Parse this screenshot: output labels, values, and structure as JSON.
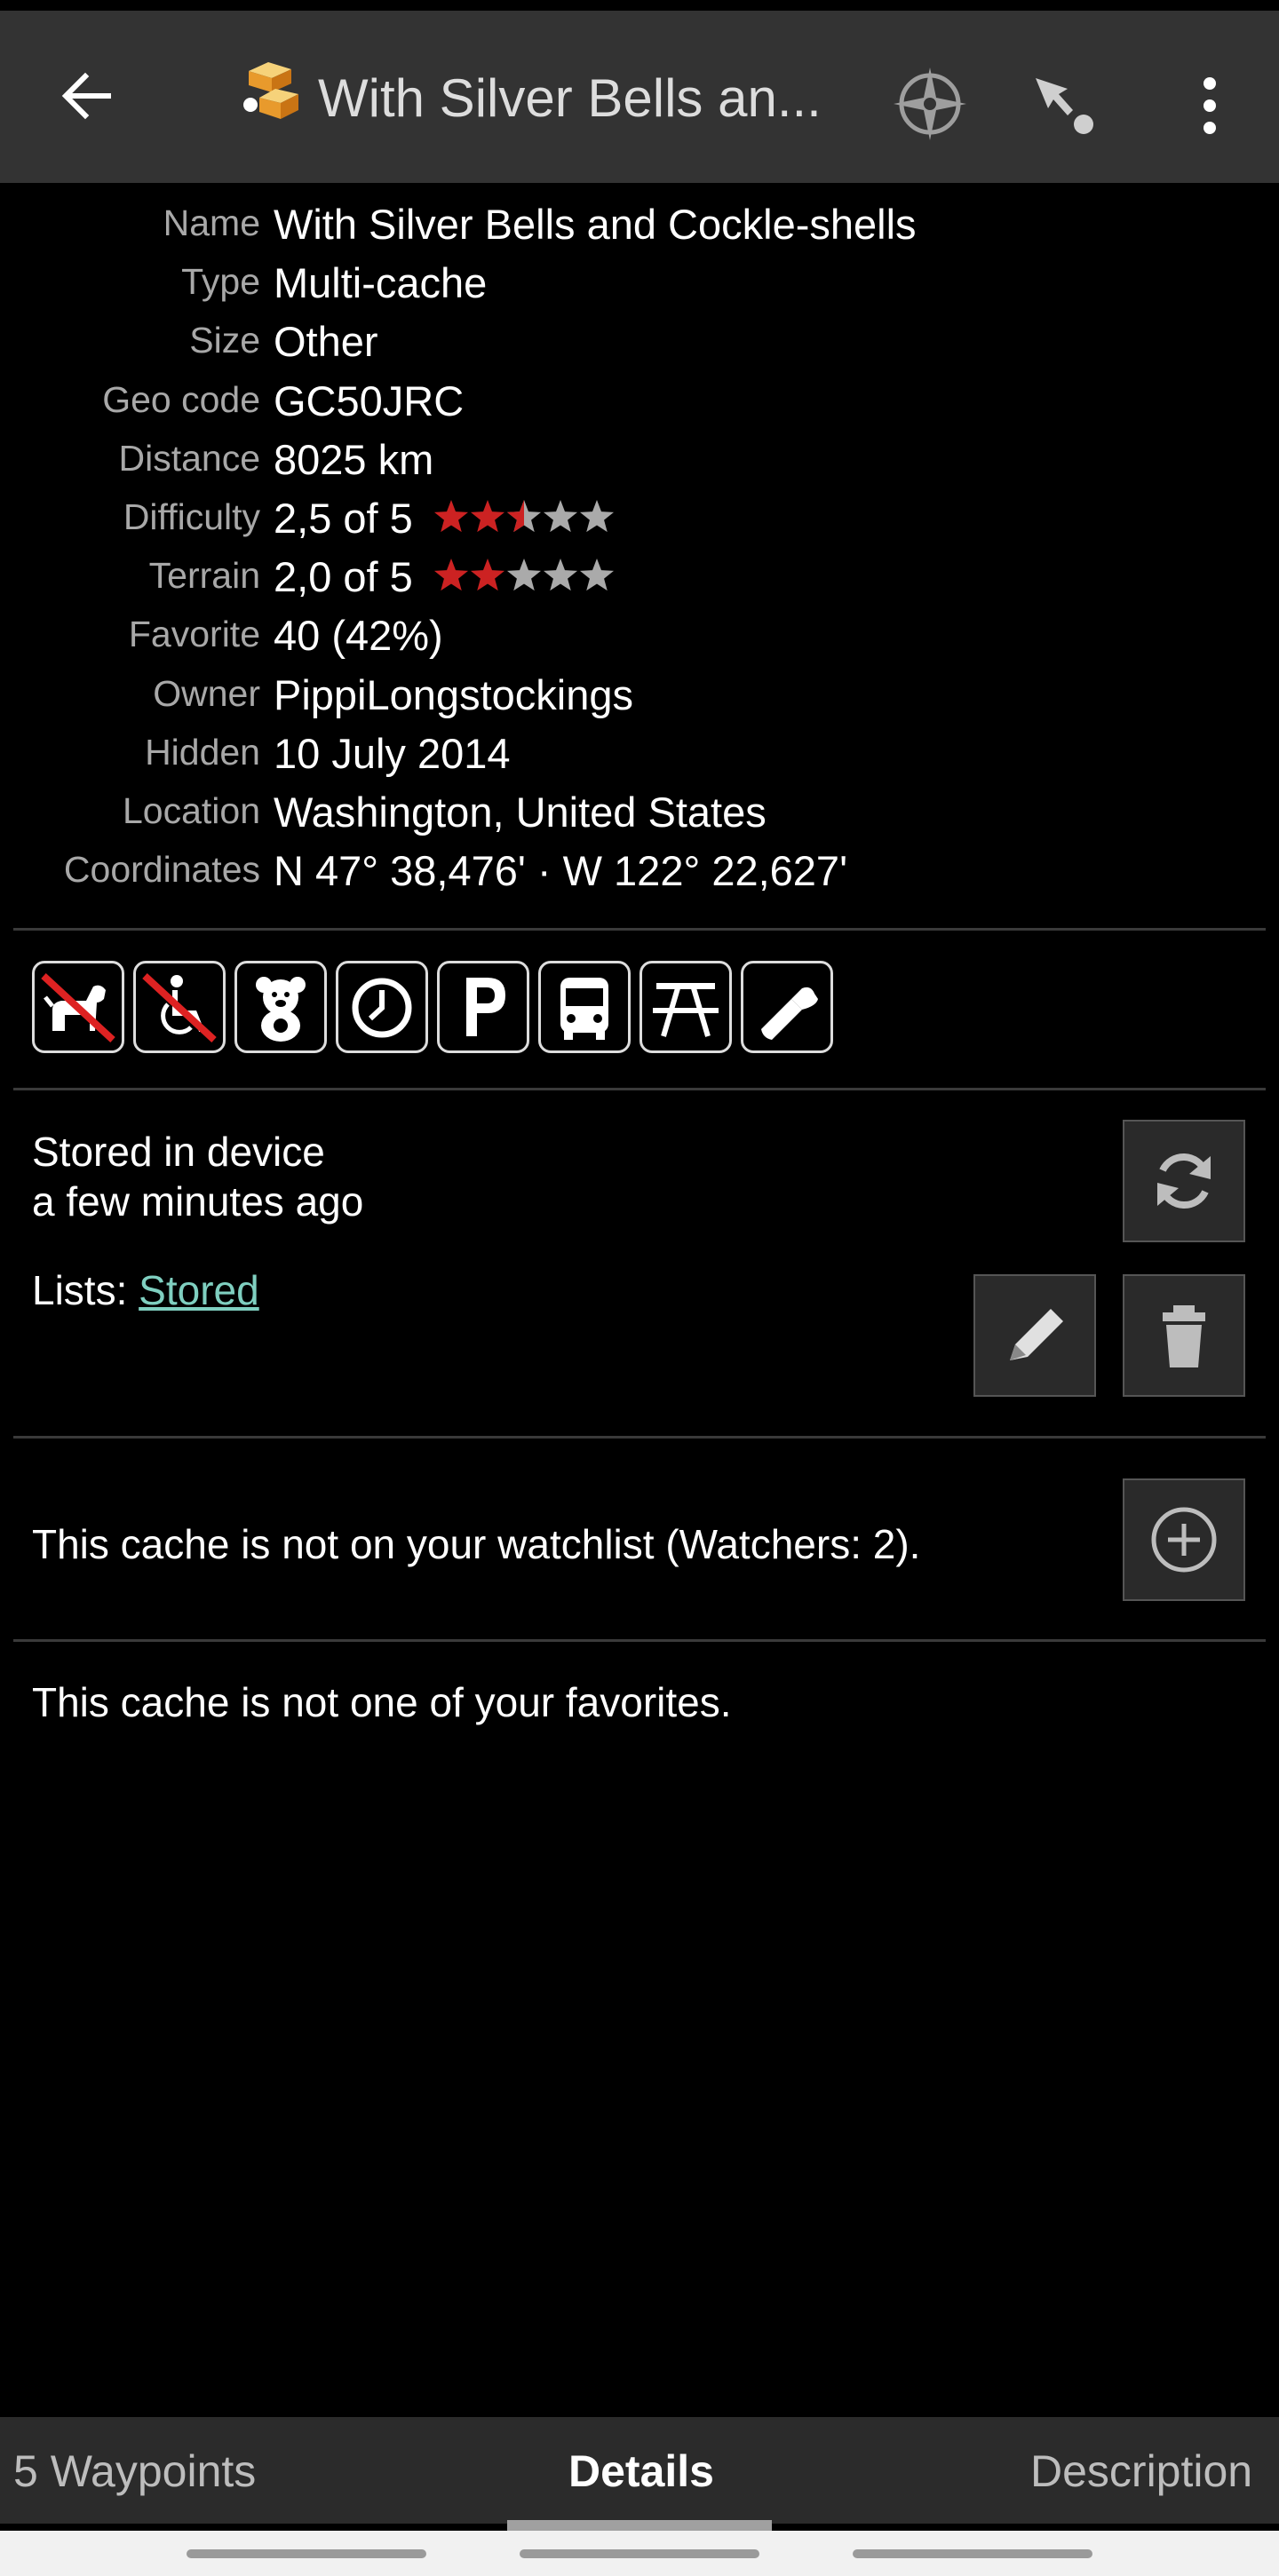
{
  "appbar": {
    "title": "With Silver Bells an...",
    "icons": [
      "back-arrow-icon",
      "multi-cache-icon",
      "compass-icon",
      "navigate-icon",
      "more-vert-icon"
    ]
  },
  "details": [
    {
      "label": "Name",
      "value": "With Silver Bells and Cockle-shells"
    },
    {
      "label": "Type",
      "value": "Multi-cache"
    },
    {
      "label": "Size",
      "value": "Other"
    },
    {
      "label": "Geo code",
      "value": "GC50JRC"
    },
    {
      "label": "Distance",
      "value": "8025 km"
    },
    {
      "label": "Difficulty",
      "value": "2,5 of 5",
      "stars": 2.5
    },
    {
      "label": "Terrain",
      "value": "2,0 of 5",
      "stars": 2.0
    },
    {
      "label": "Favorite",
      "value": "40 (42%)"
    },
    {
      "label": "Owner",
      "value": "PippiLongstockings"
    },
    {
      "label": "Hidden",
      "value": "10 July 2014"
    },
    {
      "label": "Location",
      "value": "Washington, United States"
    },
    {
      "label": "Coordinates",
      "value": "N 47° 38,476' · W 122° 22,627'"
    }
  ],
  "attributes": [
    "no-dogs-icon",
    "not-wheelchair-accessible-icon",
    "kid-friendly-icon",
    "available-24-7-icon",
    "parking-icon",
    "public-transport-icon",
    "picnic-tables-icon",
    "flashlight-icon"
  ],
  "storage": {
    "line1": "Stored in device",
    "line2": "a few minutes ago",
    "lists_label": "Lists: ",
    "lists_link": "Stored"
  },
  "watchlist": {
    "text": "This cache is not on your watchlist (Watchers: 2)."
  },
  "favorites": {
    "text": "This cache is not one of your favorites."
  },
  "tabs": [
    {
      "label": "5 Waypoints",
      "active": false
    },
    {
      "label": "Details",
      "active": true
    },
    {
      "label": "Description",
      "active": false
    }
  ],
  "colors": {
    "appbar_bg": "#333333",
    "star_red": "#cc2222",
    "star_grey": "#aaaaaa",
    "link": "#7fcfc0",
    "forbidden_red": "#dd2222"
  }
}
